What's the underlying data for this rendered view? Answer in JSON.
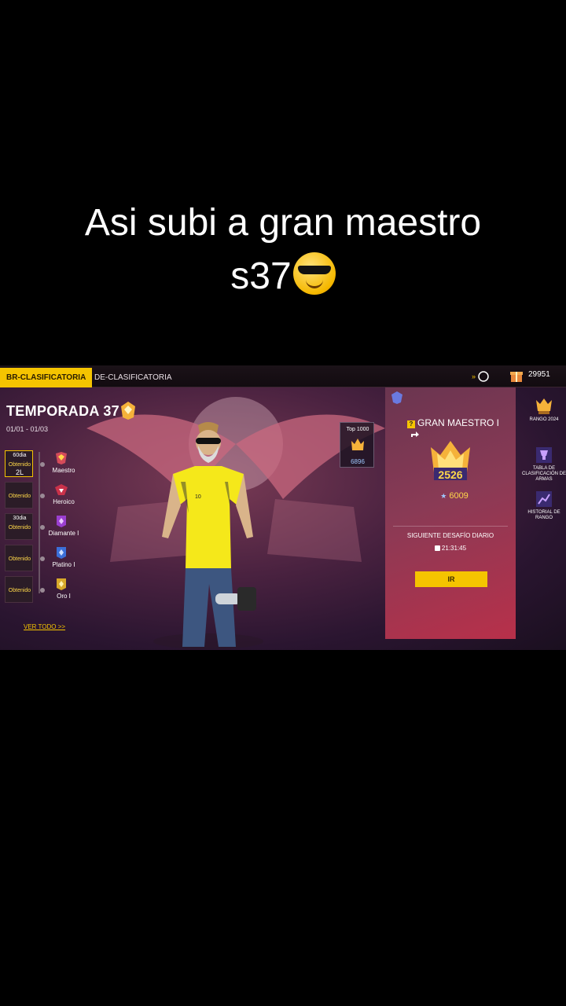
{
  "caption": {
    "line1": "Asi subi a gran maestro",
    "line2": "s37"
  },
  "tabs": {
    "br": "BR-CLASIFICATORIA",
    "de": "DE-CLASIFICATORIA"
  },
  "currency": {
    "diamonds": "29951"
  },
  "season": {
    "title": "TEMPORADA 37",
    "dates": "01/01 - 01/03"
  },
  "ranks": [
    {
      "name": "Maestro",
      "reward_days": "60dia",
      "reward_status": "Obtenido",
      "reward_code": "2L"
    },
    {
      "name": "Heroico",
      "reward_days": "",
      "reward_status": "Obtenido",
      "reward_code": ""
    },
    {
      "name": "Diamante I",
      "reward_days": "30dia",
      "reward_status": "Obtenido",
      "reward_code": ""
    },
    {
      "name": "Platino I",
      "reward_days": "",
      "reward_status": "Obtenido",
      "reward_code": ""
    },
    {
      "name": "Oro I",
      "reward_days": "",
      "reward_status": "Obtenido",
      "reward_code": ""
    }
  ],
  "ver_todo": "VER TODO >>",
  "top": {
    "label": "Top 1000",
    "value": "6896"
  },
  "panel": {
    "rank_title": "GRAN MAESTRO I",
    "badge_number": "2526",
    "score": "6009",
    "daily_label": "SIGUIENTE DESAFÍO DIARIO",
    "daily_time": "21:31:45",
    "button": "IR"
  },
  "side": {
    "rango": "RANGO 2024",
    "tabla": "TABLA DE CLASIFICACIÓN DE ARMAS",
    "historial": "HISTORIAL DE RANGO"
  },
  "colors": {
    "accent": "#f5c400",
    "panel": "#8a3a55"
  }
}
